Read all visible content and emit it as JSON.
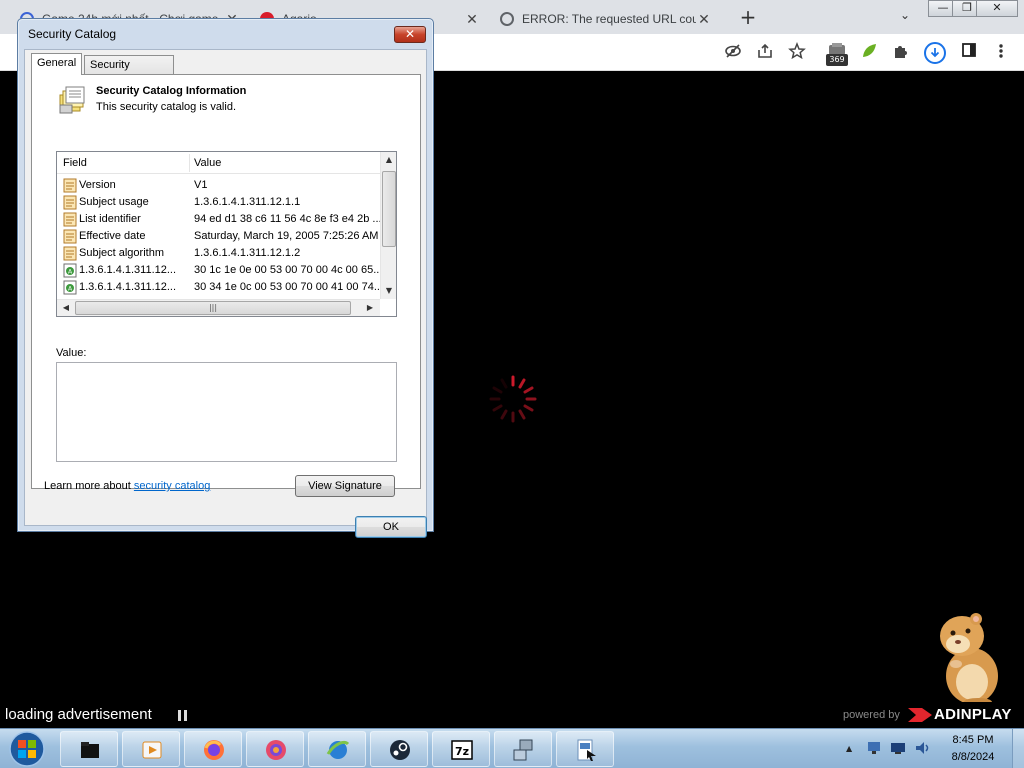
{
  "browser": {
    "tabs": [
      {
        "label": "Game 24h mới nhất - Chơi game",
        "favicon_color": "#3b63d6"
      },
      {
        "label": "Agario",
        "favicon_color": "#d91c2a"
      },
      {
        "label": "ERROR: The requested URL could",
        "favicon_color": "#5f6368"
      }
    ],
    "close_glyph": "✕",
    "new_tab_glyph": "+",
    "tab_search_glyph": "⌄",
    "window_buttons": {
      "minimize": "—",
      "maximize": "❐",
      "close": "✕"
    },
    "toolbar_icons": [
      "eye-slash-icon",
      "share-icon",
      "star-icon",
      "extension-369-icon",
      "leaf-extension-icon",
      "puzzle-icon",
      "download-icon",
      "side-panel-icon",
      "menu-icon"
    ],
    "extension_badge": "369"
  },
  "dialog": {
    "title": "Security Catalog",
    "close_glyph": "✕",
    "tabs": [
      "General",
      "Security Catalog"
    ],
    "active_tab": "General",
    "info_title": "Security Catalog Information",
    "info_subtitle": "This security catalog is valid.",
    "list": {
      "columns": [
        "Field",
        "Value"
      ],
      "rows": [
        {
          "field": "Version",
          "value": "V1",
          "icon": "document-icon"
        },
        {
          "field": "Subject usage",
          "value": "1.3.6.1.4.1.311.12.1.1",
          "icon": "document-icon"
        },
        {
          "field": "List identifier",
          "value": "94 ed d1 38 c6 11 56 4c 8e f3 e4 2b ...",
          "icon": "document-icon"
        },
        {
          "field": "Effective date",
          "value": "Saturday, March 19, 2005 7:25:26 AM",
          "icon": "document-icon"
        },
        {
          "field": "Subject algorithm",
          "value": "1.3.6.1.4.1.311.12.1.2",
          "icon": "document-icon"
        },
        {
          "field": "1.3.6.1.4.1.311.12...",
          "value": "30 1c 1e 0e 00 53 00 70 00 4c 00 65...",
          "icon": "extension-icon"
        },
        {
          "field": "1.3.6.1.4.1.311.12...",
          "value": "30 34 1e 0c 00 53 00 70 00 41 00 74...",
          "icon": "extension-icon"
        }
      ]
    },
    "value_label": "Value:",
    "value_text": "",
    "learn_prefix": "Learn more about ",
    "learn_link": "security catalog",
    "view_signature_label": "View Signature",
    "ok_label": "OK"
  },
  "ad": {
    "loading_text": "loading advertisement",
    "powered_by": "powered by",
    "brand": "ADINPLAY"
  },
  "taskbar": {
    "apps": [
      "folder-icon",
      "media-player-icon",
      "firefox-icon",
      "browser-icon",
      "ie-icon",
      "steam-icon",
      "7zip-icon",
      "network-icon",
      "document-icon"
    ],
    "tray_icons": [
      "network-tray-icon",
      "monitor-tray-icon",
      "volume-tray-icon"
    ],
    "time": "8:45 PM",
    "date": "8/8/2024"
  },
  "colors": {
    "accent_link": "#0066cc",
    "spinner": "#cc1a2b",
    "dialog_frame": "#cfdcec",
    "taskbar": "#9ec0de"
  }
}
